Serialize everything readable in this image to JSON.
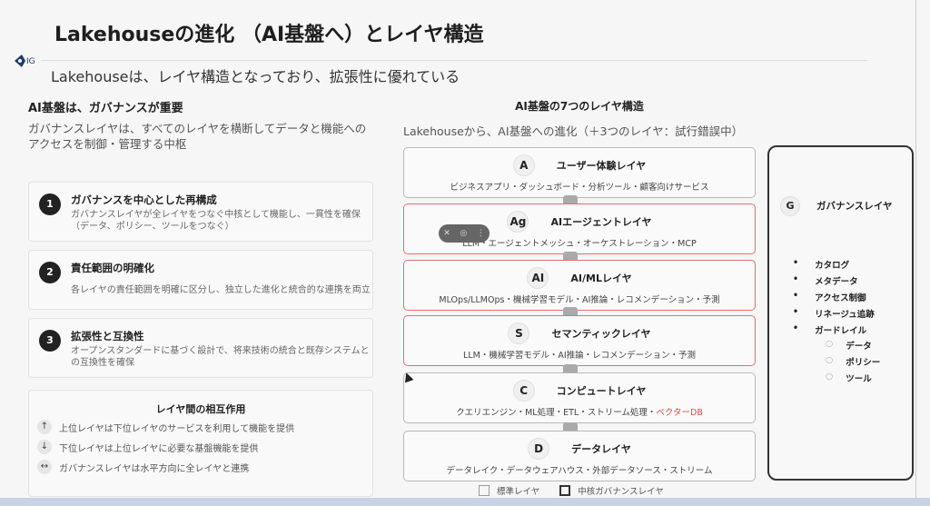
{
  "header": {
    "title": "Lakehouseの進化 （AI基盤へ）とレイヤ構造",
    "subtitle": "Lakehouseは、レイヤ構造となっており、拡張性に優れている"
  },
  "left": {
    "heading": "AI基盤は、ガバナンスが重要",
    "description": "ガバナンスレイヤは、すべてのレイヤを横断してデータと機能へのアクセスを制御・管理する中枢",
    "cards": [
      {
        "num": "1",
        "title": "ガバナンスを中心とした再構成",
        "desc": "ガバナンスレイヤが全レイヤをつなぐ中核として機能し、一貫性を確保（データ、ポリシー、ツールをつなぐ）"
      },
      {
        "num": "2",
        "title": "責任範囲の明確化",
        "desc": "各レイヤの責任範囲を明確に区分し、独立した進化と統合的な連携を両立"
      },
      {
        "num": "3",
        "title": "拡張性と互換性",
        "desc": "オープンスタンダードに基づく設計で、将来技術の統合と既存システムとの互換性を確保"
      }
    ],
    "interaction": {
      "title": "レイヤ間の相互作用",
      "items": [
        {
          "icon": "↑",
          "text": "上位レイヤは下位レイヤのサービスを利用して機能を提供"
        },
        {
          "icon": "↓",
          "text": "下位レイヤは上位レイヤに必要な基盤機能を提供"
        },
        {
          "icon": "↔",
          "text": "ガバナンスレイヤは水平方向に全レイヤと連携"
        }
      ]
    }
  },
  "right": {
    "heading": "AI基盤の7つのレイヤ構造",
    "description": "Lakehouseから、AI基盤への進化（＋3つのレイヤ：試行錯誤中）",
    "layers": [
      {
        "badge": "A",
        "name": "ユーザー体験レイヤ",
        "desc": "ビジネスアプリ・ダッシュボード・分析ツール・顧客向けサービス"
      },
      {
        "badge": "Ag",
        "name": "AIエージェントレイヤ",
        "desc": "LLM・エージェントメッシュ・オーケストレーション・MCP"
      },
      {
        "badge": "AI",
        "name": "AI/MLレイヤ",
        "desc": "MLOps/LLMOps・機械学習モデル・AI推論・レコメンデーション・予測"
      },
      {
        "badge": "S",
        "name": "セマンティックレイヤ",
        "desc": "LLM・機械学習モデル・AI推論・レコメンデーション・予測"
      },
      {
        "badge": "C",
        "name": "コンピュートレイヤ",
        "desc": "クエリエンジン・ML処理・ETL・ストリーム処理・",
        "highlight": "ベクターDB"
      },
      {
        "badge": "D",
        "name": "データレイヤ",
        "desc": "データレイク・データウェアハウス・外部データソース・ストリーム"
      }
    ],
    "governance": {
      "badge": "G",
      "name": "ガバナンスレイヤ",
      "items": [
        "カタログ",
        "メタデータ",
        "アクセス制御",
        "リネージュ追跡",
        "ガードレイル"
      ],
      "subitems": [
        "データ",
        "ポリシー",
        "ツール"
      ]
    },
    "legend": {
      "standard": "標準レイヤ",
      "core": "中核ガバナンスレイヤ"
    }
  },
  "colors": {
    "new_layer_border": "#e07070",
    "highlight": "#e04848"
  }
}
